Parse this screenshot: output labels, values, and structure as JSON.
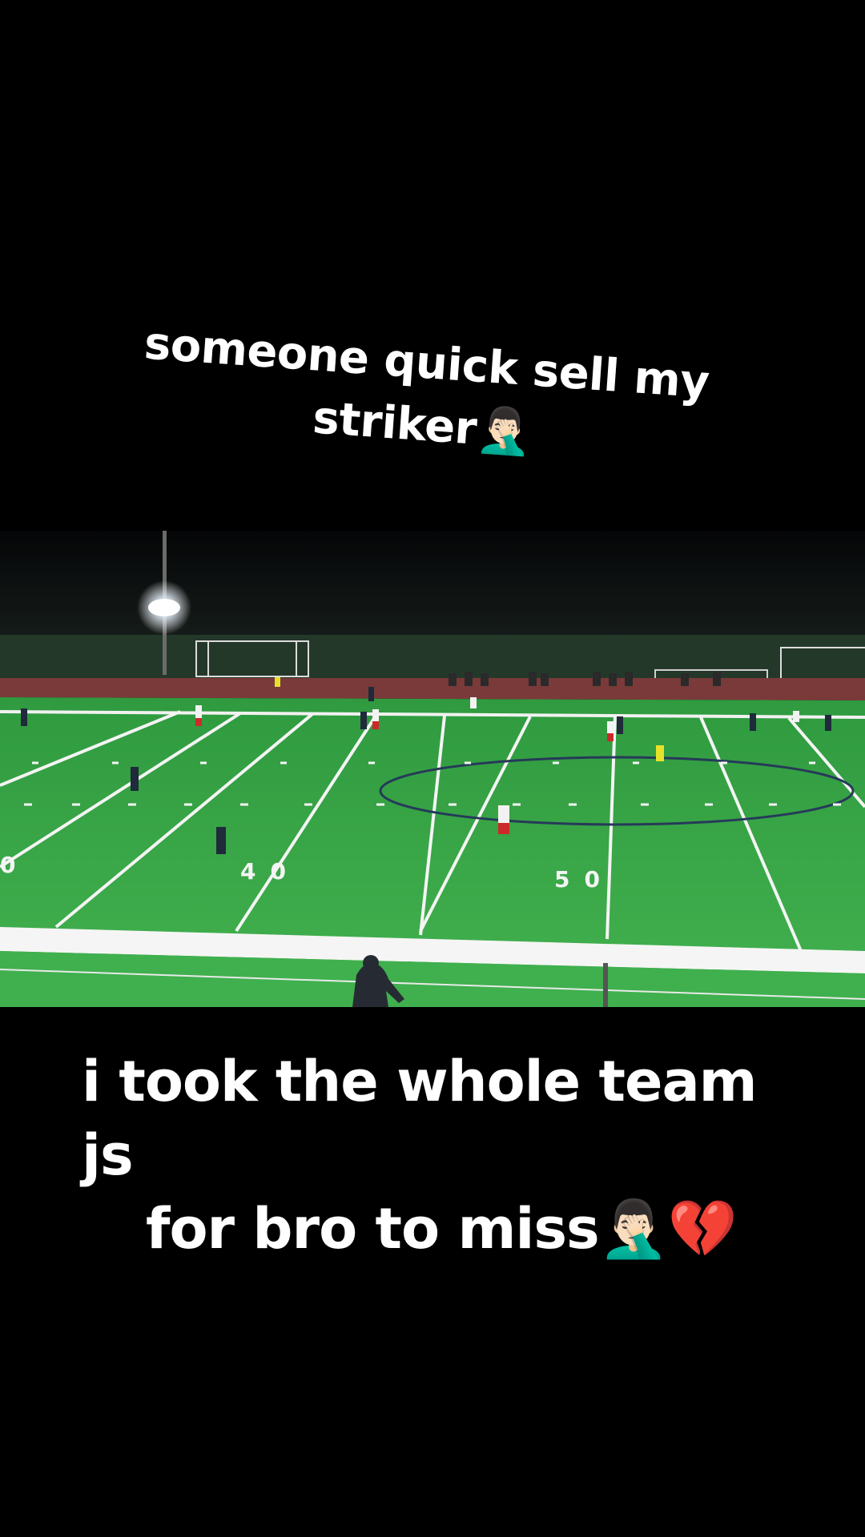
{
  "captions": {
    "top_line1": "someone quick sell my",
    "top_line2": "striker",
    "top_emoji": "🤦🏻‍♂️",
    "bottom_line1": "i took the whole team js",
    "bottom_line2": "for bro to miss",
    "bottom_emoji1": "🤦🏻‍♂️",
    "bottom_emoji2": "💔"
  },
  "field": {
    "yard_labels": [
      "0",
      "40",
      "50"
    ]
  },
  "colors": {
    "background": "#000000",
    "field_green": "#3aa84a",
    "line_white": "#f4f4f4",
    "track": "#7a3a3a"
  }
}
